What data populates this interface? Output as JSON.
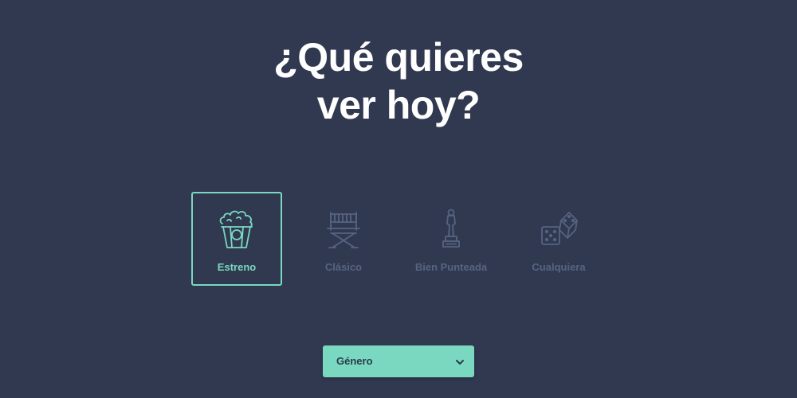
{
  "heading": {
    "line1": "¿Qué quieres",
    "line2": "ver hoy?"
  },
  "options": [
    {
      "label": "Estreno",
      "icon": "popcorn-icon",
      "selected": true
    },
    {
      "label": "Clásico",
      "icon": "director-chair-icon",
      "selected": false
    },
    {
      "label": "Bien Punteada",
      "icon": "oscar-statue-icon",
      "selected": false
    },
    {
      "label": "Cualquiera",
      "icon": "dice-icon",
      "selected": false
    }
  ],
  "genre_select": {
    "value": "Género",
    "icon": "chevron-down-icon"
  },
  "colors": {
    "background": "#313951",
    "accent": "#79d8bf",
    "inactive": "#566480",
    "heading": "#ffffff"
  }
}
